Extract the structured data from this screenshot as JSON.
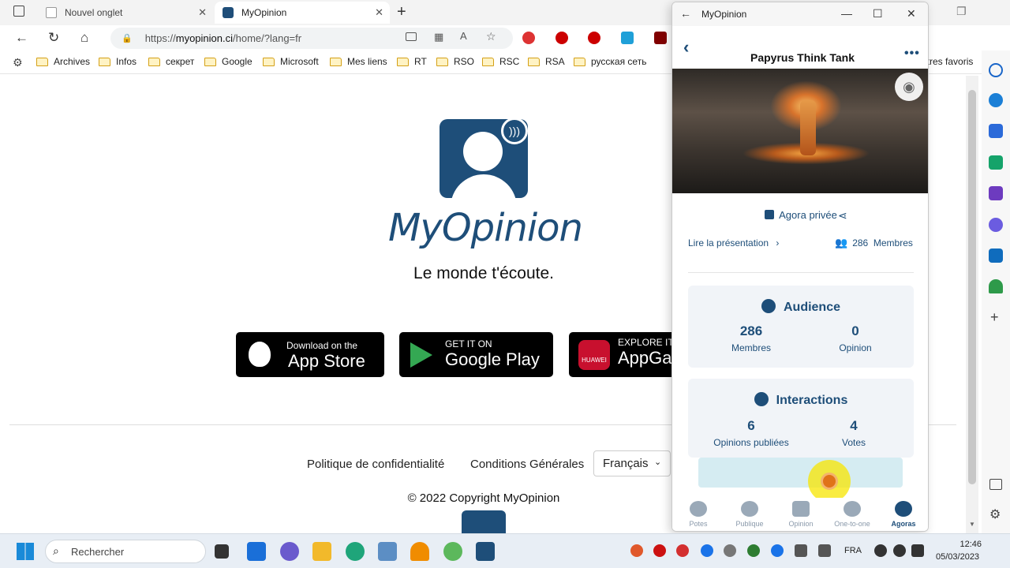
{
  "browser": {
    "tabs": [
      {
        "label": "Nouvel onglet",
        "active": false
      },
      {
        "label": "MyOpinion",
        "active": true
      }
    ],
    "url_prefix": "https://",
    "url_domain": "myopinion.ci",
    "url_path": "/home/?lang=fr",
    "bookmarks": [
      "Archives",
      "Infos",
      "секрет",
      "Google",
      "Microsoft",
      "Mes liens",
      "RT",
      "RSO",
      "RSC",
      "RSA",
      "русская сеть"
    ],
    "other_favorites": "Autres favoris"
  },
  "page": {
    "brand": "MyOpinion",
    "tagline": "Le monde t'écoute.",
    "stores": [
      {
        "small": "Download on the",
        "big": "App Store"
      },
      {
        "small": "GET IT ON",
        "big": "Google Play"
      },
      {
        "small": "EXPLORE IT",
        "big": "AppGallery",
        "badge": "HUAWEI"
      }
    ],
    "footer_links": [
      "Politique de confidentialité",
      "Conditions Générales"
    ],
    "language": "Français",
    "copyright": "© 2022 Copyright MyOpinion"
  },
  "app": {
    "window_title": "MyOpinion",
    "header_title": "Papyrus Think Tank",
    "privacy": "Agora privée",
    "read_presentation": "Lire la présentation",
    "members_count": "286",
    "members_label": "Membres",
    "audience": {
      "title": "Audience",
      "stats": [
        {
          "value": "286",
          "label": "Membres"
        },
        {
          "value": "0",
          "label": "Opinion"
        }
      ]
    },
    "interactions": {
      "title": "Interactions",
      "stats": [
        {
          "value": "6",
          "label": "Opinions publiées"
        },
        {
          "value": "4",
          "label": "Votes"
        }
      ]
    },
    "nav": [
      "Potes",
      "Publique",
      "Opinion",
      "One-to-one",
      "Agoras"
    ],
    "active_nav": "Agoras"
  },
  "taskbar": {
    "search_placeholder": "Rechercher",
    "lang": "FRA",
    "time": "12:46",
    "date": "05/03/2023"
  },
  "colors": {
    "brand": "#1e4e79",
    "card_bg": "#f1f4f8",
    "loading": "#d5ecf2"
  }
}
